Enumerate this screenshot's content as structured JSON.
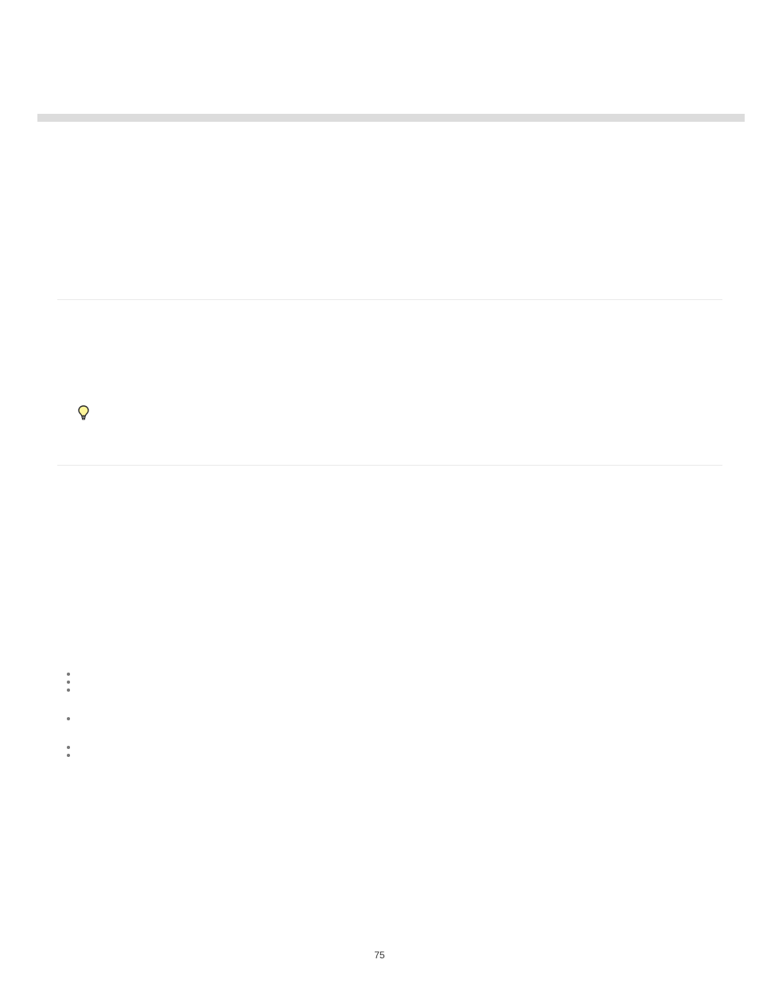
{
  "page_number": "75",
  "callout": {
    "text": ""
  },
  "bullets": {
    "group1": [
      "",
      "",
      ""
    ],
    "group2": [
      ""
    ],
    "group3": [
      "",
      ""
    ]
  }
}
